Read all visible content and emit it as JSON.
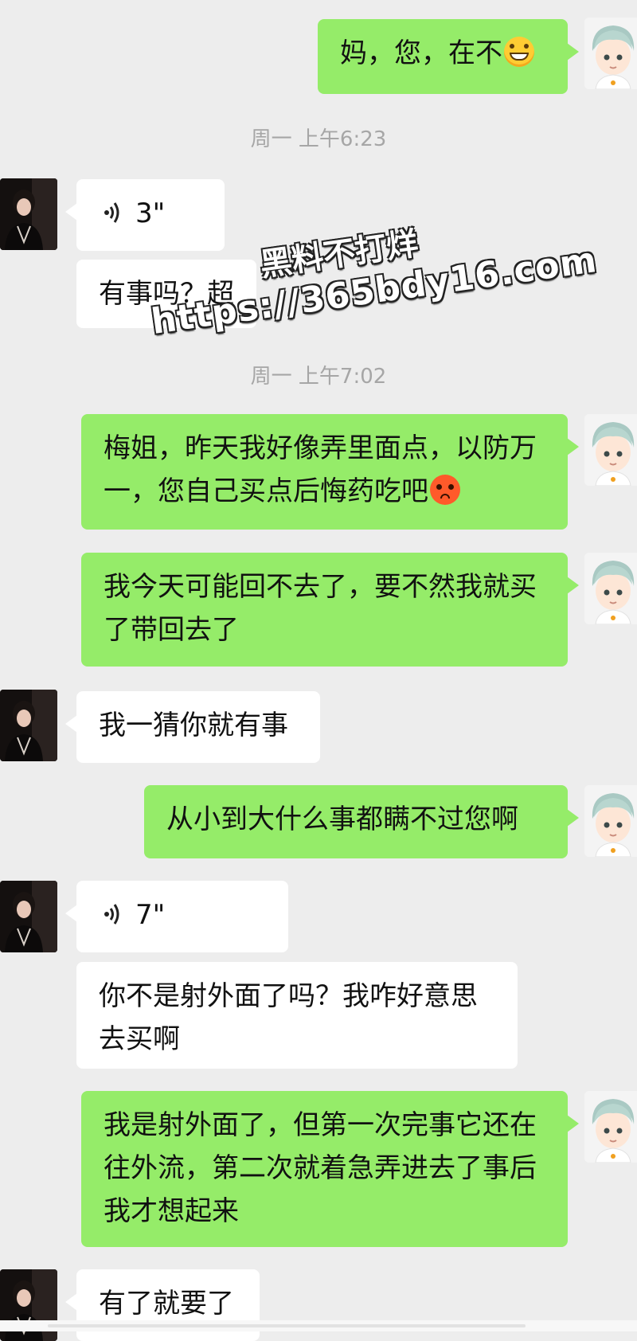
{
  "colors": {
    "background": "#ededed",
    "sent_bubble": "#95ec69",
    "received_bubble": "#ffffff",
    "timestamp_text": "#a6a6a6"
  },
  "messages": [
    {
      "side": "right",
      "type": "text",
      "text": "妈，您，在不",
      "emoji": "grinning-face-emoji"
    },
    {
      "type": "timestamp",
      "text": "周一 上午6:23"
    },
    {
      "side": "left",
      "type": "voice",
      "duration": "3\""
    },
    {
      "side": "left",
      "type": "text",
      "text": "有事吗？超"
    },
    {
      "type": "timestamp",
      "text": "周一 上午7:02"
    },
    {
      "side": "right",
      "type": "text",
      "text": "梅姐，昨天我好像弄里面点，以防万一，您自己买点后悔药吃吧",
      "emoji": "anxious-face-emoji"
    },
    {
      "side": "right",
      "type": "text",
      "text": "我今天可能回不去了，要不然我就买了带回去了"
    },
    {
      "side": "left",
      "type": "text",
      "text": "我一猜你就有事"
    },
    {
      "side": "right",
      "type": "text",
      "text": "从小到大什么事都瞒不过您啊"
    },
    {
      "side": "left",
      "type": "voice",
      "duration": "7\""
    },
    {
      "side": "left",
      "type": "text",
      "text": "你不是射外面了吗？我咋好意思去买啊"
    },
    {
      "side": "right",
      "type": "text",
      "text": "我是射外面了，但第一次完事它还在往外流，第二次就着急弄进去了事后我才想起来"
    },
    {
      "side": "left",
      "type": "text",
      "text": "有了就要了"
    }
  ],
  "watermark": {
    "line1": "黑料不打烊",
    "line2": "https://365bdy16.com"
  }
}
